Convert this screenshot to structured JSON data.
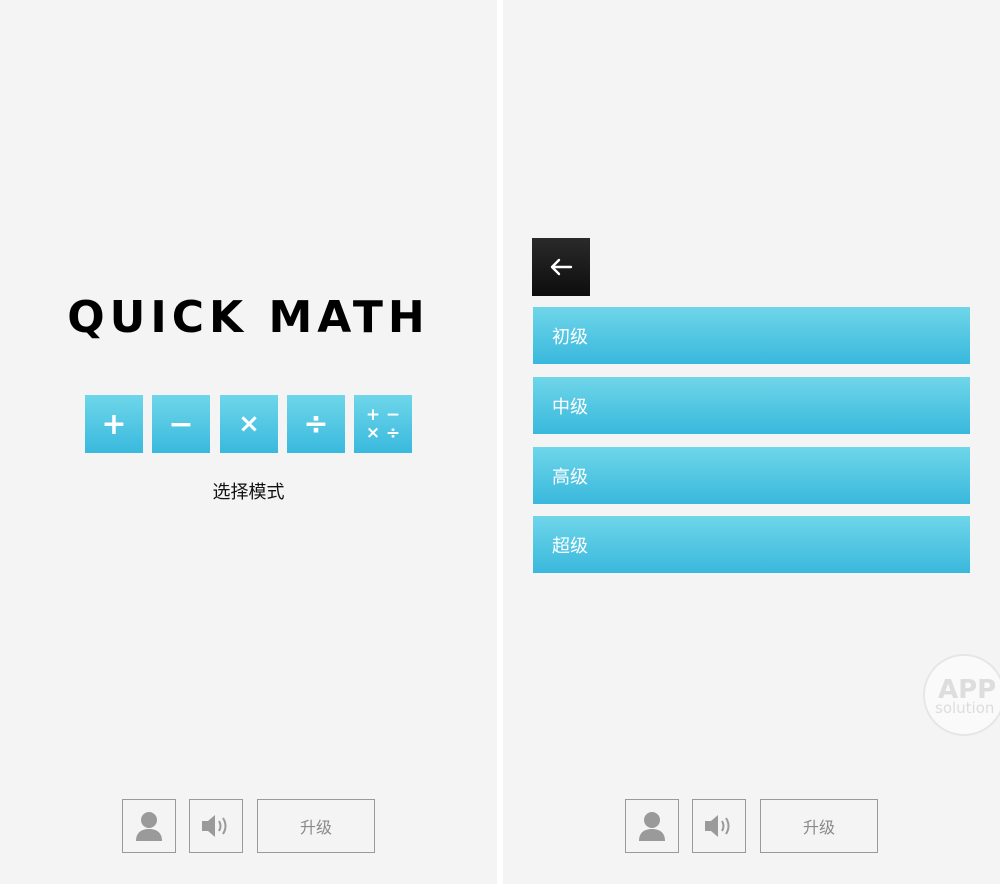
{
  "home": {
    "title": "QUICK MATH",
    "modes": [
      {
        "symbol": "+"
      },
      {
        "symbol": "−"
      },
      {
        "symbol": "×"
      },
      {
        "symbol": "÷"
      },
      {
        "symbols": [
          "+",
          "−",
          "×",
          "÷"
        ]
      }
    ],
    "hint": "选择模式"
  },
  "levels": {
    "items": [
      {
        "label": "初级"
      },
      {
        "label": "中级"
      },
      {
        "label": "高级"
      },
      {
        "label": "超级"
      }
    ]
  },
  "toolbar": {
    "upgrade_label": "升级"
  },
  "watermark": {
    "main": "APP",
    "sub": "solution"
  },
  "colors": {
    "accent_top": "#6ed6e9",
    "accent_bottom": "#39b9de",
    "background": "#f4f4f4",
    "back_button": "#111111",
    "toolbar_border": "#9a9a9a"
  },
  "icons": {
    "profile": "person-icon",
    "sound": "speaker-icon",
    "back": "arrow-left-icon"
  }
}
